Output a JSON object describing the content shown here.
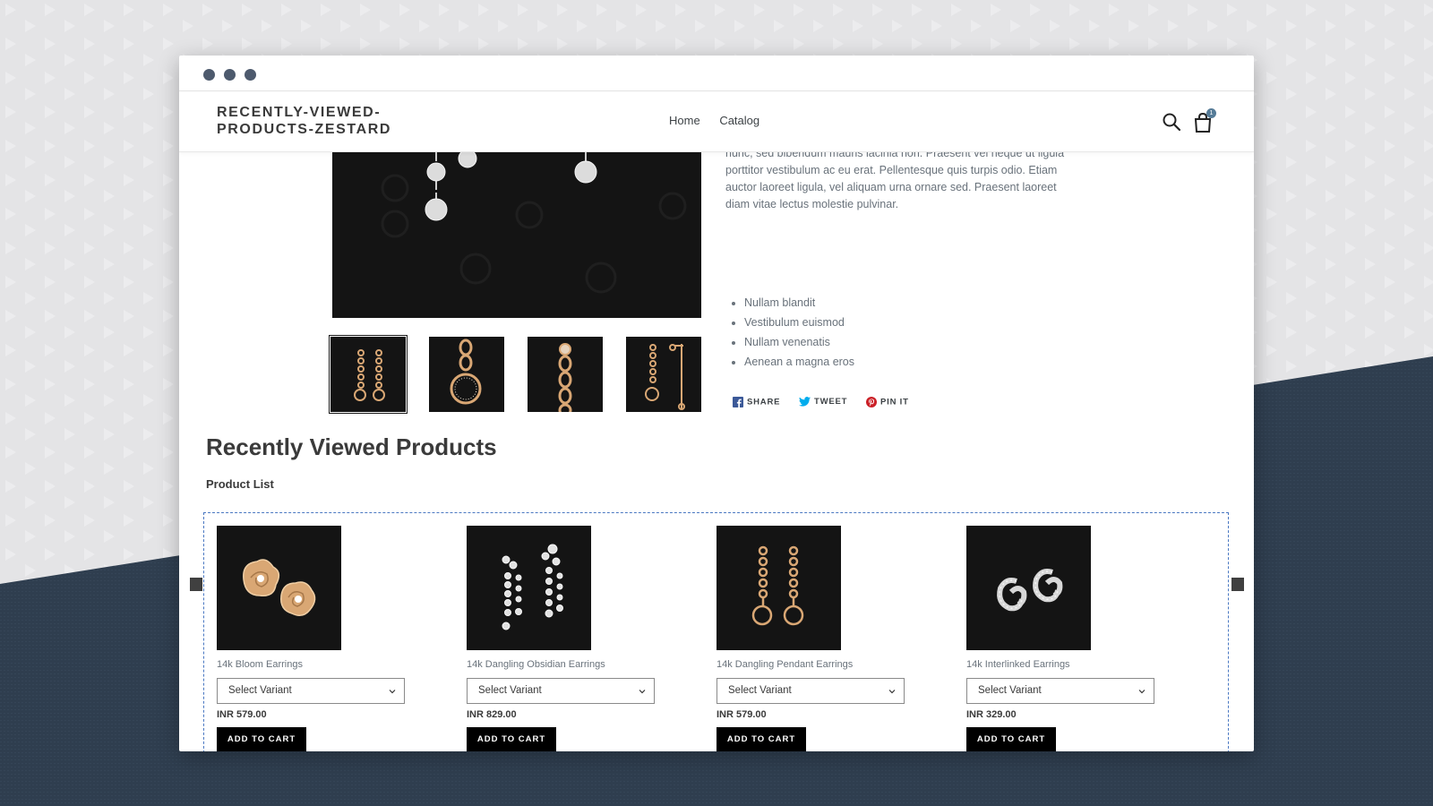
{
  "header": {
    "logo": "RECENTLY-VIEWED-PRODUCTS-ZESTARD",
    "nav": [
      "Home",
      "Catalog"
    ],
    "cart_count": "1"
  },
  "product": {
    "description": "nunc, sed bibendum mauris lacinia non. Praesent vel neque ut ligula porttitor vestibulum ac eu erat. Pellentesque quis turpis odio. Etiam auctor laoreet ligula, vel aliquam urna ornare sed. Praesent laoreet diam vitae lectus molestie pulvinar.",
    "bullets": [
      "Nullam blandit",
      "Vestibulum euismod",
      "Nullam venenatis",
      "Aenean a magna eros"
    ],
    "share": {
      "facebook": "SHARE",
      "twitter": "TWEET",
      "pinterest": "PIN IT"
    }
  },
  "recently_viewed": {
    "title": "Recently Viewed Products",
    "subtitle": "Product List",
    "items": [
      {
        "name": "14k Bloom Earrings",
        "variant": "Select Variant",
        "price": "INR 579.00",
        "button": "ADD TO CART"
      },
      {
        "name": "14k Dangling Obsidian Earrings",
        "variant": "Select Variant",
        "price": "INR 829.00",
        "button": "ADD TO CART"
      },
      {
        "name": "14k Dangling Pendant Earrings",
        "variant": "Select Variant",
        "price": "INR 579.00",
        "button": "ADD TO CART"
      },
      {
        "name": "14k Interlinked Earrings",
        "variant": "Select Variant",
        "price": "INR 329.00",
        "button": "ADD TO CART"
      }
    ]
  },
  "colors": {
    "background_dark": "#2f3e4f",
    "background_light": "#e4e4e6",
    "button": "#000000",
    "dashed_border": "#4a78c2",
    "gold": "#d9a774",
    "silver": "#d7d7d7"
  }
}
